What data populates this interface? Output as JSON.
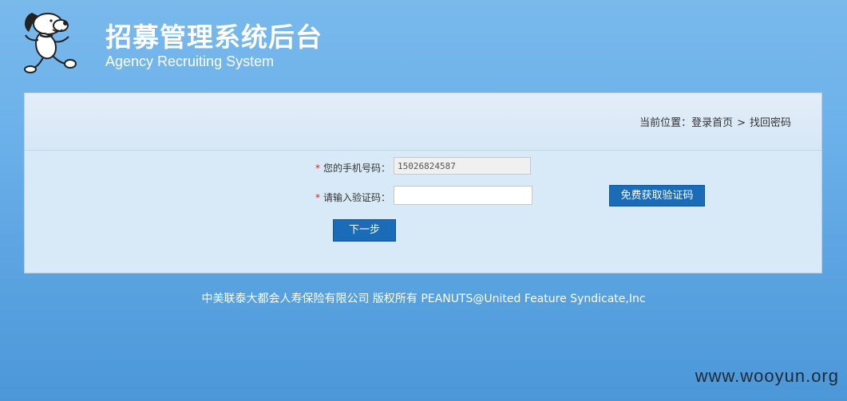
{
  "header": {
    "title_cn": "招募管理系统后台",
    "title_en": "Agency Recruiting System"
  },
  "breadcrumb": {
    "prefix": "当前位置：登录首页",
    "separator": ">",
    "current": "找回密码"
  },
  "form": {
    "phone": {
      "required_mark": "*",
      "label": "您的手机号码：",
      "value": "15026824587"
    },
    "code": {
      "required_mark": "*",
      "label": "请输入验证码：",
      "value": ""
    },
    "get_code_label": "免费获取验证码",
    "next_label": "下一步"
  },
  "footer": {
    "text": "中美联泰大都会人寿保险有限公司 版权所有 PEANUTS@United Feature Syndicate,Inc"
  },
  "watermark": {
    "text": "www.wooyun.org"
  },
  "colors": {
    "background": "#6db2ea",
    "panel": "#d8e9f7",
    "button": "#1a6cb8",
    "required": "#e02020"
  },
  "icons": {
    "logo": "snoopy-dancing-icon"
  }
}
